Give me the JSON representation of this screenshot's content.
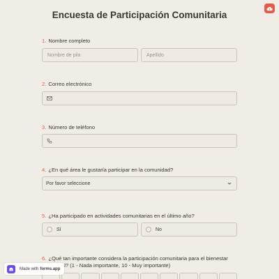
{
  "title": "Encuesta de Participación Comunitaria",
  "questions": {
    "q1": {
      "num": "1.",
      "label": "Nombre completo",
      "first_placeholder": "Nombre de pila",
      "last_placeholder": "Apellido"
    },
    "q2": {
      "num": "2.",
      "label": "Correo electrónico"
    },
    "q3": {
      "num": "3.",
      "label": "Número de teléfono"
    },
    "q4": {
      "num": "4.",
      "label": "¿En qué área le gustaría participar en la comunidad?",
      "select_value": "Por favor seleccione"
    },
    "q5": {
      "num": "5.",
      "label": "¿Ha participado en actividades comunitarias en el último año?",
      "options": [
        "Sí",
        "No"
      ]
    },
    "q6": {
      "num": "6.",
      "label_line1": "¿Qué tan importante considera la participación comunitaria para el bienestar",
      "label_line2": "al? (1 - Nada importante, 10 - Muy importante)"
    }
  },
  "badge": {
    "prefix": "Made with",
    "brand": "forms.app"
  },
  "colors": {
    "accent": "#e45a4a",
    "number": "#d6604e",
    "background": "#f0ede6",
    "badge_logo": "#6c4de0"
  },
  "icons": {
    "corner": "cloud-upload-icon",
    "email": "mail-icon",
    "phone": "phone-icon",
    "select": "chevron-down-icon",
    "badge": "forms-app-logo-icon"
  }
}
